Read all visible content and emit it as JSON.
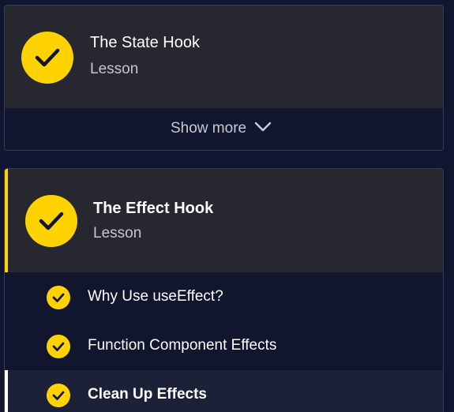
{
  "modules": [
    {
      "title": "The State Hook",
      "type": "Lesson",
      "status_icon": "check-circle-icon",
      "show_more_label": "Show more"
    },
    {
      "title": "The Effect Hook",
      "type": "Lesson",
      "status_icon": "check-circle-icon",
      "items": [
        {
          "label": "Why Use useEffect?",
          "completed": true
        },
        {
          "label": "Function Component Effects",
          "completed": true
        },
        {
          "label": "Clean Up Effects",
          "completed": true,
          "current": true
        }
      ]
    }
  ],
  "colors": {
    "background": "#10162f",
    "card_header": "#27282f",
    "accent": "#ffd300",
    "text": "#ffffff",
    "muted_text": "#c6c7cc"
  }
}
